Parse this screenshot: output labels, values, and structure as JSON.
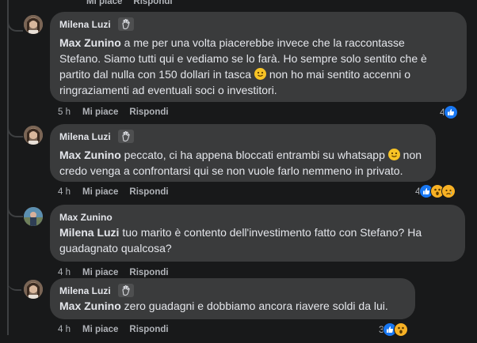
{
  "top_meta": {
    "time": "",
    "like": "Mi piace",
    "reply": "Rispondi"
  },
  "comments": [
    {
      "author": "Milena Luzi",
      "mention": "Max Zunino",
      "text_lines": [
        " a me per una volta piacerebbe invece che la raccontasse",
        "Stefano. Siamo tutti qui e vediamo se lo farà. Ho sempre solo sentito che è",
        "partito dal nulla con 150 dollari in tasca ",
        " non ho mai sentito accenni o",
        "ringraziamenti ad eventuali soci o investitori."
      ],
      "time": "5 h",
      "like": "Mi piace",
      "reply": "Rispondi",
      "reaction_count": "4",
      "reactions": [
        "like"
      ]
    },
    {
      "author": "Milena Luzi",
      "mention": "Max Zunino",
      "text_lines": [
        " peccato, ci ha appena bloccati entrambi su whatsapp ",
        " non",
        "credo venga a confrontarsi qui se non vuole farlo nemmeno in privato."
      ],
      "time": "4 h",
      "like": "Mi piace",
      "reply": "Rispondi",
      "reaction_count": "4",
      "reactions": [
        "like",
        "wow",
        "sad"
      ]
    },
    {
      "author": "Max Zunino",
      "mention": "Milena Luzi",
      "text_lines": [
        " tuo marito è contento dell'investimento fatto con Stefano? Ha",
        "guadagnato qualcosa?"
      ],
      "time": "4 h",
      "like": "Mi piace",
      "reply": "Rispondi"
    },
    {
      "author": "Milena Luzi",
      "mention": "Max Zunino",
      "text_lines": [
        " zero guadagni e dobbiamo ancora riavere soldi da lui."
      ],
      "time": "4 h",
      "like": "Mi piace",
      "reply": "Rispondi",
      "reaction_count": "3",
      "reactions": [
        "like",
        "wow"
      ]
    }
  ],
  "colors": {
    "background": "#18191a",
    "bubble": "#3a3b3c",
    "like": "#1877f2",
    "emoji": "#f7b125"
  }
}
